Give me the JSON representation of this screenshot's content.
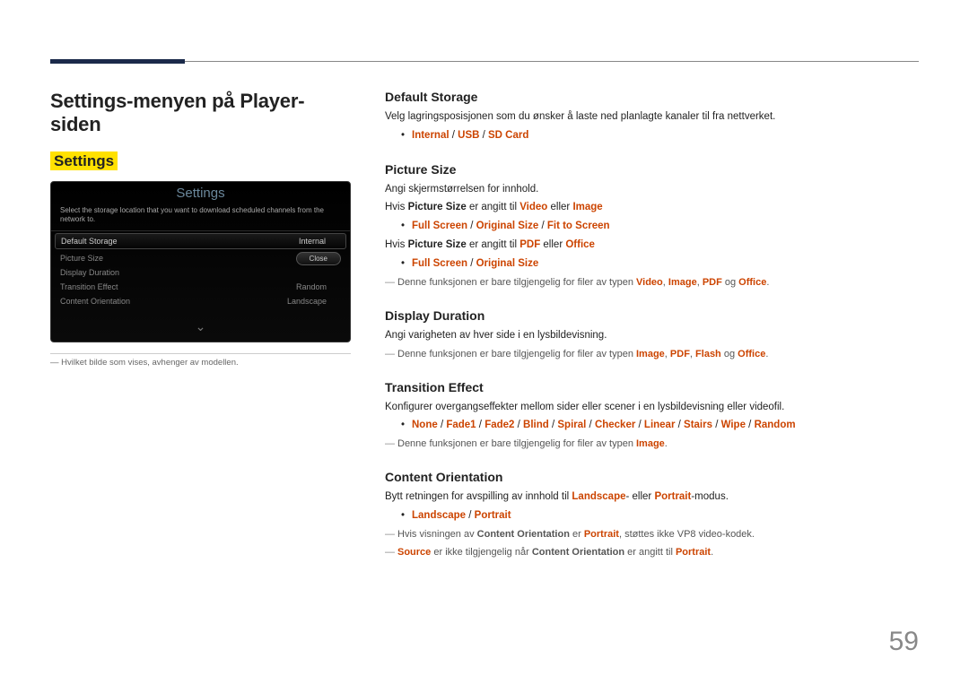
{
  "page": {
    "title": "Settings-menyen på Player-siden",
    "subtitle": "Settings",
    "pageNumber": "59"
  },
  "screenshot": {
    "title": "Settings",
    "desc": "Select the storage location that you want to download scheduled channels from the network to.",
    "rows": [
      {
        "label": "Default Storage",
        "value": "Internal",
        "selected": true
      },
      {
        "label": "Picture Size",
        "value": "",
        "selected": false
      },
      {
        "label": "Display Duration",
        "value": "",
        "selected": false
      },
      {
        "label": "Transition Effect",
        "value": "Random",
        "selected": false
      },
      {
        "label": "Content Orientation",
        "value": "Landscape",
        "selected": false
      }
    ],
    "close": "Close",
    "footnote": "Hvilket bilde som vises, avhenger av modellen."
  },
  "sections": {
    "defaultStorage": {
      "title": "Default Storage",
      "p1": "Velg lagringsposisjonen som du ønsker å laste ned planlagte kanaler til fra nettverket.",
      "opt": {
        "a": "Internal",
        "b": "USB",
        "c": "SD Card"
      }
    },
    "pictureSize": {
      "title": "Picture Size",
      "p1": "Angi skjermstørrelsen for innhold.",
      "line2": {
        "pre": "Hvis ",
        "b1": "Picture Size",
        "mid": " er angitt til ",
        "r1": "Video",
        "or": " eller ",
        "r2": "Image"
      },
      "opt1": {
        "a": "Full Screen",
        "b": "Original Size",
        "c": "Fit to Screen"
      },
      "line3": {
        "pre": "Hvis ",
        "b1": "Picture Size",
        "mid": " er angitt til ",
        "r1": "PDF",
        "or": " eller ",
        "r2": "Office"
      },
      "opt2": {
        "a": "Full Screen",
        "b": "Original Size"
      },
      "note": {
        "pre": "Denne funksjonen er bare tilgjengelig for filer av typen ",
        "r1": "Video",
        "r2": "Image",
        "r3": "PDF",
        "og": " og ",
        "r4": "Office",
        "end": "."
      }
    },
    "displayDuration": {
      "title": "Display Duration",
      "p1": "Angi varigheten av hver side i en lysbildevisning.",
      "note": {
        "pre": "Denne funksjonen er bare tilgjengelig for filer av typen ",
        "r1": "Image",
        "r2": "PDF",
        "r3": "Flash",
        "og": " og ",
        "r4": "Office",
        "end": "."
      }
    },
    "transitionEffect": {
      "title": "Transition Effect",
      "p1": "Konfigurer overgangseffekter mellom sider eller scener i en lysbildevisning eller videofil.",
      "opts": [
        "None",
        "Fade1",
        "Fade2",
        "Blind",
        "Spiral",
        "Checker",
        "Linear",
        "Stairs",
        "Wipe",
        "Random"
      ],
      "note": {
        "pre": "Denne funksjonen er bare tilgjengelig for filer av typen ",
        "r1": "Image",
        "end": "."
      }
    },
    "contentOrientation": {
      "title": "Content Orientation",
      "p1": {
        "pre": "Bytt retningen for avspilling av innhold til ",
        "r1": "Landscape",
        "mid": "- eller ",
        "r2": "Portrait",
        "end": "-modus."
      },
      "opt": {
        "a": "Landscape",
        "b": "Portrait"
      },
      "note1": {
        "pre": "Hvis visningen av ",
        "b1": "Content Orientation",
        "mid": " er ",
        "r1": "Portrait",
        "end": ", støttes ikke VP8 video-kodek."
      },
      "note2": {
        "r1": "Source",
        "mid": " er ikke tilgjengelig når ",
        "b1": "Content Orientation",
        "mid2": " er angitt til ",
        "r2": "Portrait",
        "end": "."
      }
    }
  }
}
